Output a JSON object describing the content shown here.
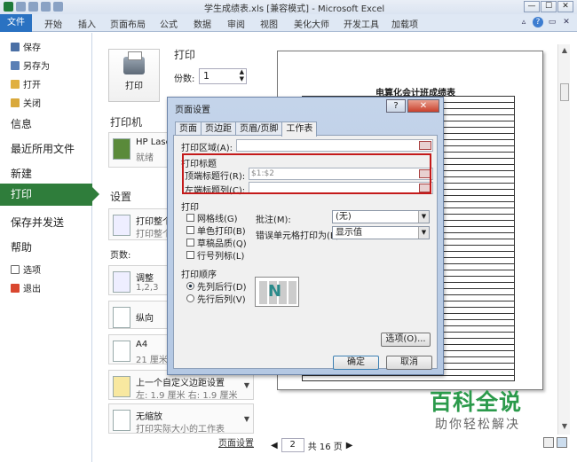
{
  "window": {
    "title": "学生成绩表.xls [兼容模式] - Microsoft Excel",
    "controls": [
      "—",
      "☐",
      "✕"
    ]
  },
  "ribbon": {
    "file_tab": "文件",
    "tabs": [
      "开始",
      "插入",
      "页面布局",
      "公式",
      "数据",
      "审阅",
      "视图",
      "美化大师",
      "开发工具",
      "加载项"
    ]
  },
  "sidebar": {
    "save": "保存",
    "save_as": "另存为",
    "open": "打开",
    "close": "关闭",
    "info": "信息",
    "recent": "最近所用文件",
    "new": "新建",
    "print": "打印",
    "save_send": "保存并发送",
    "help": "帮助",
    "options": "选项",
    "exit": "退出"
  },
  "print_panel": {
    "heading": "打印",
    "copies_label": "份数:",
    "copies_value": "1",
    "print_button": "打印",
    "printer_heading": "打印机",
    "printer_name": "HP Lase",
    "printer_status": "就绪",
    "settings_heading": "设置",
    "pages_label": "页数:",
    "setting_print_what": "打印整个",
    "setting_print_what_sub": "打印整个",
    "setting_collate": "调整",
    "setting_collate_sub": "1,2,3",
    "setting_orientation": "纵向",
    "setting_paper": "A4",
    "setting_paper_sub": "21 厘米",
    "setting_margins": "上一个自定义边距设置",
    "setting_margins_sub": "左: 1.9 厘米   右: 1.9 厘米",
    "setting_scaling": "无缩放",
    "setting_scaling_sub": "打印实际大小的工作表",
    "page_setup_link": "页面设置"
  },
  "preview": {
    "sheet_title": "电算化会计班成绩表",
    "current_page": "2",
    "total_pages": "共 16 页"
  },
  "dialog": {
    "title": "页面设置",
    "help_btn": "?",
    "close_btn": "✕",
    "tabs": [
      "页面",
      "页边距",
      "页眉/页脚",
      "工作表"
    ],
    "print_area_label": "打印区域(A):",
    "print_titles_label": "打印标题",
    "top_rows_label": "顶端标题行(R):",
    "top_rows_value": "$1:$2",
    "left_cols_label": "左端标题列(C):",
    "left_cols_value": "",
    "print_section_label": "打印",
    "gridlines": "网格线(G)",
    "mono": "单色打印(B)",
    "draft": "草稿品质(Q)",
    "row_col_headings": "行号列标(L)",
    "comments_label": "批注(M):",
    "comments_value": "(无)",
    "errors_label": "错误单元格打印为(E):",
    "errors_value": "显示值",
    "order_label": "打印顺序",
    "down_then_over": "先列后行(D)",
    "over_then_down": "先行后列(V)",
    "options_btn": "选项(O)...",
    "ok_btn": "确定",
    "cancel_btn": "取消"
  },
  "watermark": {
    "title": "百科全说",
    "subtitle": "助你轻松解决"
  },
  "colors": {
    "accent_green": "#2f7d3b",
    "file_tab_blue": "#2a72c2",
    "highlight_red": "#c41a1a",
    "watermark_green": "#2b9a4b"
  }
}
